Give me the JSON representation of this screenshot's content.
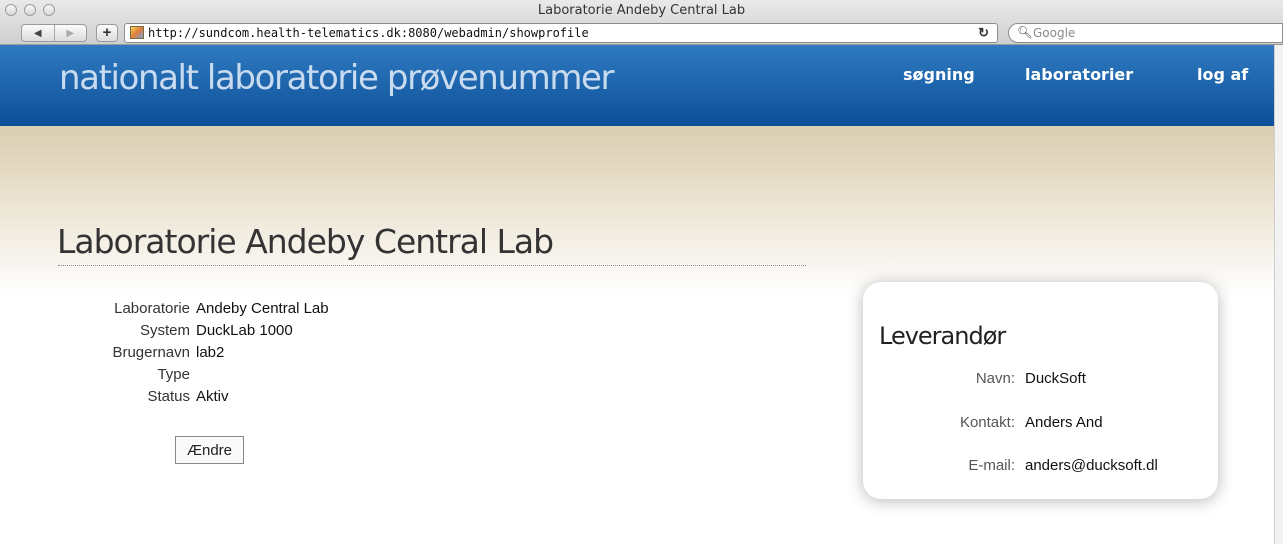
{
  "browser": {
    "window_title": "Laboratorie Andeby Central Lab",
    "nav": {
      "back": "◀",
      "forward": "▶",
      "add": "+"
    },
    "url": "http://sundcom.health-telematics.dk:8080/webadmin/showprofile",
    "reload_icon": "↻",
    "search_placeholder": "Google"
  },
  "site": {
    "title": "nationalt laboratorie prøvenummer",
    "nav": {
      "search": "søgning",
      "labs": "laboratorier",
      "logout": "log af"
    },
    "colors": {
      "header": "#1560a8",
      "band": "#cdbf9f"
    }
  },
  "page": {
    "title": "Laboratorie Andeby Central Lab",
    "fields": [
      {
        "label": "Laboratorie",
        "value": "Andeby Central Lab"
      },
      {
        "label": "System",
        "value": "DuckLab 1000"
      },
      {
        "label": "Brugernavn",
        "value": "lab2"
      },
      {
        "label": "Type",
        "value": ""
      },
      {
        "label": "Status",
        "value": "Aktiv"
      }
    ],
    "edit_button": "Ændre"
  },
  "supplier": {
    "title": "Leverandør",
    "name_label": "Navn:",
    "name_value": "DuckSoft",
    "contact_label": "Kontakt:",
    "contact_value": "Anders And",
    "email_label": "E-mail:",
    "email_value": "anders@ducksoft.dl"
  }
}
